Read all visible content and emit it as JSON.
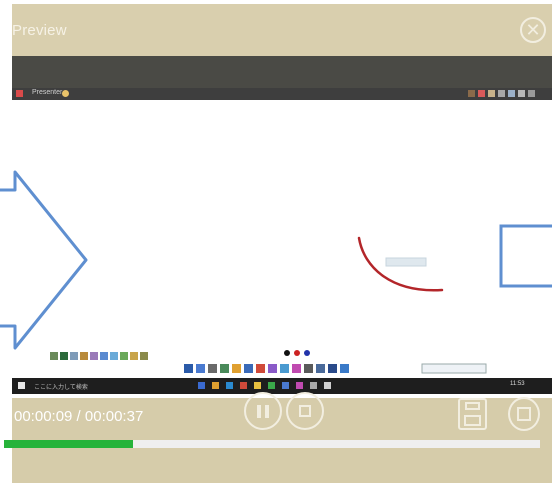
{
  "window": {
    "title": "Preview",
    "close_icon": "close-circle-icon"
  },
  "video": {
    "app_label": "Presenter",
    "taskbar_search_placeholder": "ここに入力して検索",
    "clock": "11:53"
  },
  "controls": {
    "time_display": "00:00:09 / 00:00:37",
    "pause_icon": "pause-icon",
    "stop_icon": "stop-icon",
    "save_icon": "save-icon",
    "copy_icon": "copy-icon",
    "progress_fraction": 0.24
  },
  "colors": {
    "window_bg": "#d6ccaa",
    "dark_bar": "#4a4a45",
    "progress_fill": "#26b33a",
    "annotation_stroke": "#b3262a",
    "arrow_stroke": "#5f8fd0"
  }
}
